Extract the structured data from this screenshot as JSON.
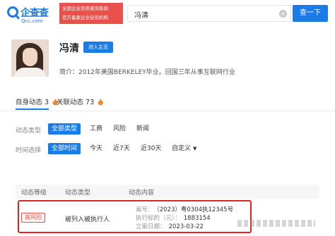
{
  "header": {
    "logo_cn": "企查查",
    "logo_domain": "Qcc.com",
    "tagline_line1": "全国企业信用查询系统",
    "tagline_line2": "官方备案企业征信机构",
    "search_value": "冯清",
    "search_button": "查一下"
  },
  "profile": {
    "name": "冯清",
    "home_button": "进入主页",
    "bio": "简介：2012年美国BERKELEY毕业。回国三年从事互联网行业"
  },
  "tabs": [
    {
      "label": "自身动态",
      "count": "3",
      "active": true
    },
    {
      "label": "关联动态",
      "count": "73",
      "active": false
    }
  ],
  "filters": {
    "type_label": "动态类型",
    "type_options": [
      "全部类型",
      "工商",
      "风险",
      "新闻"
    ],
    "time_label": "时间选择",
    "time_options": [
      "全部时间",
      "今天",
      "近7天",
      "近30天",
      "自定义"
    ]
  },
  "table": {
    "columns": [
      "动态等级",
      "动态类型",
      "动态内容"
    ],
    "rows": [
      {
        "level": "高风险",
        "type": "被列入被执行人",
        "content": [
          {
            "key": "案号：",
            "value": "（2023）粤0304执12345号"
          },
          {
            "key": "执行标的（元）：",
            "value": "1883154"
          },
          {
            "key": "立案日期：",
            "value": "2023-03-22"
          }
        ]
      }
    ]
  },
  "colors": {
    "brand": "#1a7ce8",
    "risk": "#e8514c",
    "highlight": "#e0231f"
  }
}
